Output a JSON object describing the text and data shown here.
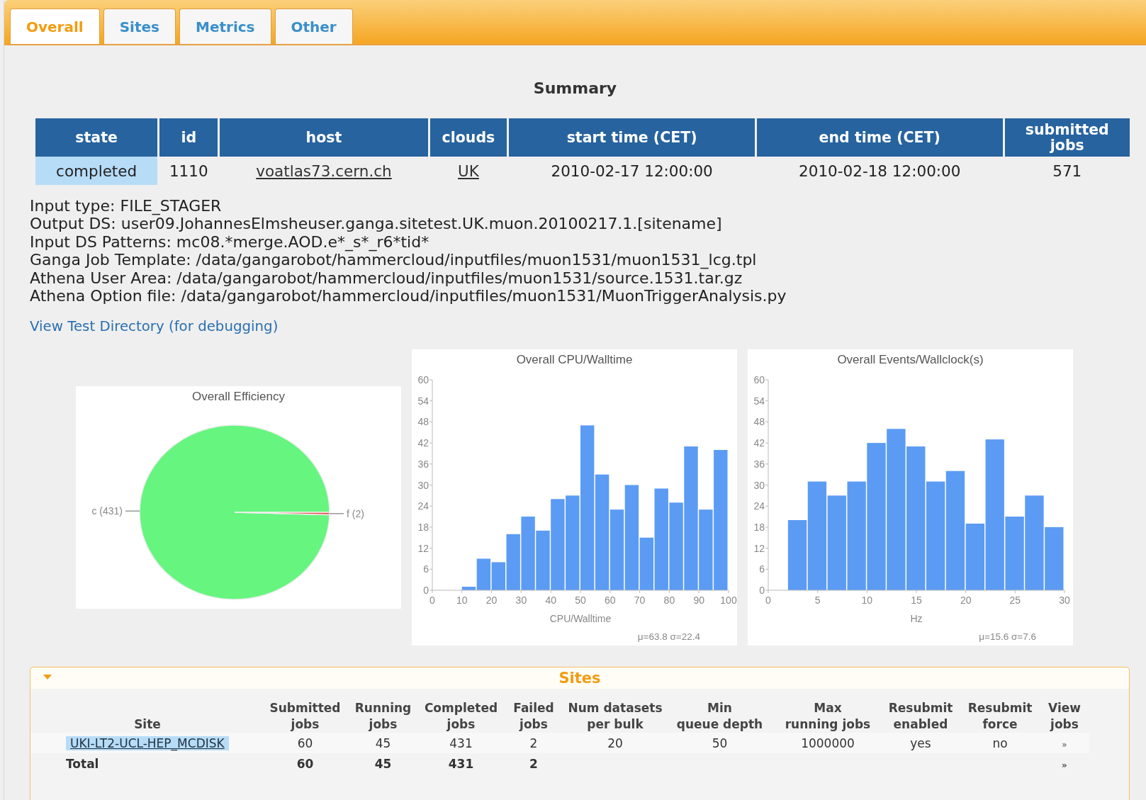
{
  "tabs": [
    {
      "label": "Overall",
      "selected": true
    },
    {
      "label": "Sites",
      "selected": false
    },
    {
      "label": "Metrics",
      "selected": false
    },
    {
      "label": "Other",
      "selected": false
    }
  ],
  "summary": {
    "title": "Summary",
    "columns": [
      "state",
      "id",
      "host",
      "clouds",
      "start time (CET)",
      "end time (CET)",
      "submitted\njobs"
    ],
    "rows": [
      {
        "state": "completed",
        "id": "1110",
        "host": "voatlas73.cern.ch",
        "clouds": "UK",
        "start": "2010-02-17 12:00:00",
        "end": "2010-02-18 12:00:00",
        "submitted": "571"
      }
    ]
  },
  "details": [
    "Input type: FILE_STAGER",
    "Output DS: user09.JohannesElmsheuser.ganga.sitetest.UK.muon.20100217.1.[sitename]",
    "Input DS Patterns: mc08.*merge.AOD.e*_s*_r6*tid*",
    "Ganga Job Template: /data/gangarobot/hammercloud/inputfiles/muon1531/muon1531_lcg.tpl",
    "Athena User Area: /data/gangarobot/hammercloud/inputfiles/muon1531/source.1531.tar.gz",
    "Athena Option file: /data/gangarobot/hammercloud/inputfiles/muon1531/MuonTriggerAnalysis.py"
  ],
  "debug_link": "View Test Directory (for debugging)",
  "charts": [
    {
      "chart_data": {
        "type": "pie",
        "title": "Overall Efficiency",
        "categories": [
          "c (431)",
          "f (2)"
        ],
        "values": [
          431,
          2
        ]
      }
    },
    {
      "chart_data": {
        "type": "bar",
        "title": "Overall CPU/Walltime",
        "xlabel": "CPU/Walltime",
        "x": [
          12.5,
          17.5,
          22.5,
          27.5,
          32.5,
          37.5,
          42.5,
          47.5,
          52.5,
          57.5,
          62.5,
          67.5,
          72.5,
          77.5,
          82.5,
          87.5,
          92.5,
          97.5
        ],
        "values": [
          1,
          9,
          8,
          16,
          21,
          17,
          26,
          27,
          47,
          33,
          23,
          30,
          15,
          29,
          25,
          41,
          23,
          40
        ],
        "xlim": [
          0,
          100
        ],
        "ylim": [
          0,
          60
        ],
        "xticks": [
          0,
          10,
          20,
          30,
          40,
          50,
          60,
          70,
          80,
          90,
          100
        ],
        "yticks": [
          0,
          6,
          12,
          18,
          24,
          30,
          36,
          42,
          48,
          54,
          60
        ],
        "annotations": [
          "μ=63.8 σ=22.4"
        ]
      }
    },
    {
      "chart_data": {
        "type": "bar",
        "title": "Overall Events/Wallclock(s)",
        "xlabel": "Hz",
        "x": [
          3,
          5,
          7,
          9,
          11,
          13,
          15,
          17,
          19,
          21,
          23,
          25,
          27,
          29
        ],
        "values": [
          20,
          31,
          27,
          31,
          42,
          46,
          41,
          31,
          34,
          19,
          43,
          21,
          27,
          18
        ],
        "xlim": [
          0,
          30
        ],
        "ylim": [
          0,
          60
        ],
        "xticks": [
          0,
          5,
          10,
          15,
          20,
          25,
          30
        ],
        "yticks": [
          0,
          6,
          12,
          18,
          24,
          30,
          36,
          42,
          48,
          54,
          60
        ],
        "annotations": [
          "μ=15.6 σ=7.6"
        ]
      }
    }
  ],
  "sites_panel": {
    "title": "Sites",
    "expanded": true,
    "columns": [
      "Site",
      "Submitted\njobs",
      "Running\njobs",
      "Completed\njobs",
      "Failed\njobs",
      "Num datasets\nper bulk",
      "Min\nqueue depth",
      "Max\nrunning jobs",
      "Resubmit\nenabled",
      "Resubmit\nforce",
      "View\njobs"
    ],
    "rows": [
      {
        "kind": "site",
        "cells": [
          "UKI-LT2-UCL-HEP_MCDISK",
          "60",
          "45",
          "431",
          "2",
          "20",
          "50",
          "1000000",
          "yes",
          "no",
          "»"
        ]
      },
      {
        "kind": "total",
        "cells": [
          "Total",
          "60",
          "45",
          "431",
          "2",
          null,
          null,
          null,
          null,
          null,
          "»"
        ]
      }
    ]
  }
}
